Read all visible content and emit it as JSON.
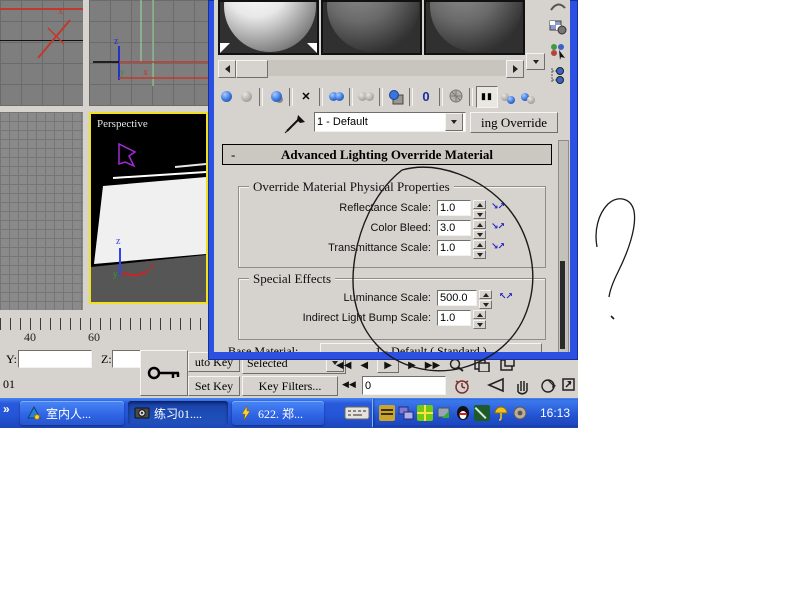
{
  "ui": {
    "dropdown_arrow": "▼",
    "chevron": "»",
    "collapse": "-",
    "wire1": "↘↗",
    "wire2": "↖↗",
    "playback": [
      "◀◀",
      "◀",
      "▶",
      "▶",
      "▶▶"
    ],
    "key_step": "◀◀"
  },
  "icon_glyphs": {
    "reset-map-icon": "✕",
    "material-id-channel-icon": "0",
    "show-end-result-icon": "▮▮"
  },
  "viewports": {
    "perspective_label": "Perspective"
  },
  "timeline": {
    "tick_labels": [
      "40",
      "60"
    ]
  },
  "material_editor": {
    "material_name": "1 - Default",
    "type_button": "ing Override",
    "rollout": {
      "title": "Advanced Lighting Override Material"
    },
    "groups": [
      {
        "title": "Override Material Physical Properties",
        "rows": [
          {
            "label": "Reflectance Scale:",
            "value": "1.0"
          },
          {
            "label": "Color Bleed:",
            "value": "3.0"
          },
          {
            "label": "Transmittance Scale:",
            "value": "1.0"
          }
        ]
      },
      {
        "title": "Special Effects",
        "rows": [
          {
            "label": "Luminance Scale:",
            "value": "500.0"
          },
          {
            "label": "Indirect Light Bump Scale:",
            "value": "1.0"
          }
        ]
      }
    ],
    "base_material": {
      "label": "Base Material:",
      "button": "1 - Default ( Standard )"
    }
  },
  "status_bar": {
    "y_label": "Y:",
    "z_label": "Z:",
    "prompt": "01",
    "auto_key": "uto Key",
    "set_key": "Set Key",
    "selected": "Selected",
    "key_filters": "Key Filters...",
    "frame_value": "0"
  },
  "taskbar": {
    "tasks": [
      {
        "label": "室内人..."
      },
      {
        "label": "练习01...."
      },
      {
        "label": "622. 郑..."
      }
    ],
    "clock": "16:13"
  }
}
